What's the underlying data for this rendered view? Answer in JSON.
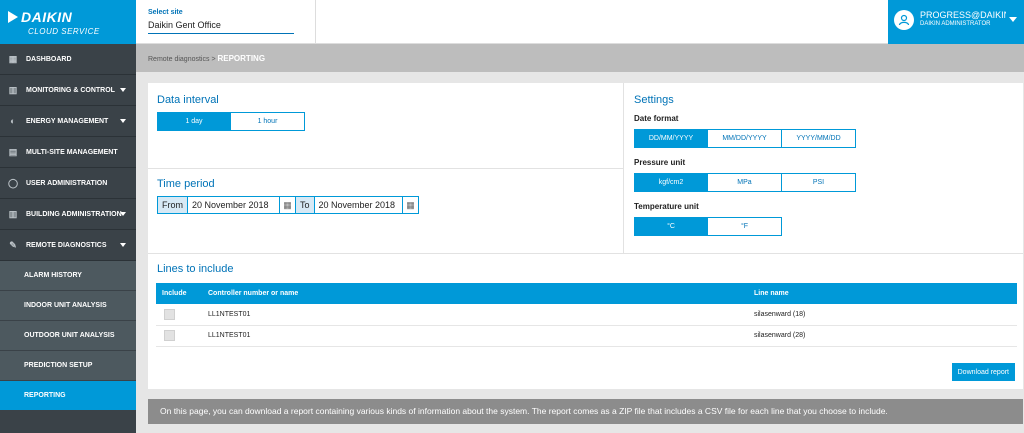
{
  "brand": {
    "name": "DAIKIN",
    "sub": "CLOUD SERVICE"
  },
  "sidebar": {
    "items": [
      {
        "label": "DASHBOARD",
        "icon": "grid-icon",
        "caret": false
      },
      {
        "label": "MONITORING & CONTROL",
        "icon": "building-icon",
        "caret": true
      },
      {
        "label": "ENERGY MANAGEMENT",
        "icon": "energy-icon",
        "caret": true
      },
      {
        "label": "MULTI-SITE MANAGEMENT",
        "icon": "sites-icon",
        "caret": false
      },
      {
        "label": "USER ADMINISTRATION",
        "icon": "user-icon",
        "caret": false
      },
      {
        "label": "BUILDING ADMINISTRATION",
        "icon": "building-admin-icon",
        "caret": true
      },
      {
        "label": "REMOTE DIAGNOSTICS",
        "icon": "wrench-icon",
        "caret": true
      }
    ],
    "sub_items": [
      {
        "label": "ALARM HISTORY"
      },
      {
        "label": "INDOOR UNIT ANALYSIS"
      },
      {
        "label": "OUTDOOR UNIT ANALYSIS"
      },
      {
        "label": "PREDICTION SETUP"
      },
      {
        "label": "REPORTING"
      }
    ]
  },
  "header": {
    "site_label": "Select site",
    "site_value": "Daikin Gent Office",
    "user_name": "PROGRESS@DAIKIN...",
    "user_role": "DAIKIN ADMINISTRATOR"
  },
  "breadcrumb": {
    "parent": "Remote diagnostics",
    "sep": ">",
    "current": "REPORTING"
  },
  "data_interval": {
    "title": "Data interval",
    "options": [
      "1 day",
      "1 hour"
    ],
    "selected": "1 day"
  },
  "time_period": {
    "title": "Time period",
    "from_label": "From",
    "from_value": "20 November 2018",
    "to_label": "To",
    "to_value": "20 November 2018"
  },
  "settings": {
    "title": "Settings",
    "date_format_label": "Date format",
    "date_format_options": [
      "DD/MM/YYYY",
      "MM/DD/YYYY",
      "YYYY/MM/DD"
    ],
    "date_format_selected": "DD/MM/YYYY",
    "pressure_label": "Pressure unit",
    "pressure_options": [
      "kgf/cm2",
      "MPa",
      "PSI"
    ],
    "pressure_selected": "kgf/cm2",
    "temperature_label": "Temperature unit",
    "temperature_options": [
      "°C",
      "°F"
    ],
    "temperature_selected": "°C"
  },
  "lines": {
    "title": "Lines to include",
    "columns": [
      "Include",
      "Controller number or name",
      "Line name"
    ],
    "rows": [
      {
        "controller": "LL1NTEST01",
        "line": "silasenward (18)"
      },
      {
        "controller": "LL1NTEST01",
        "line": "silasenward (28)"
      }
    ]
  },
  "download_label": "Download report",
  "footer_note": "On this page, you can download a report containing various kinds of information about the system. The report comes as a ZIP file that includes a CSV file for each line that you choose to include.",
  "colors": {
    "accent": "#0099d8",
    "sidebar": "#3a4248",
    "sub_sidebar": "#4d595f"
  }
}
